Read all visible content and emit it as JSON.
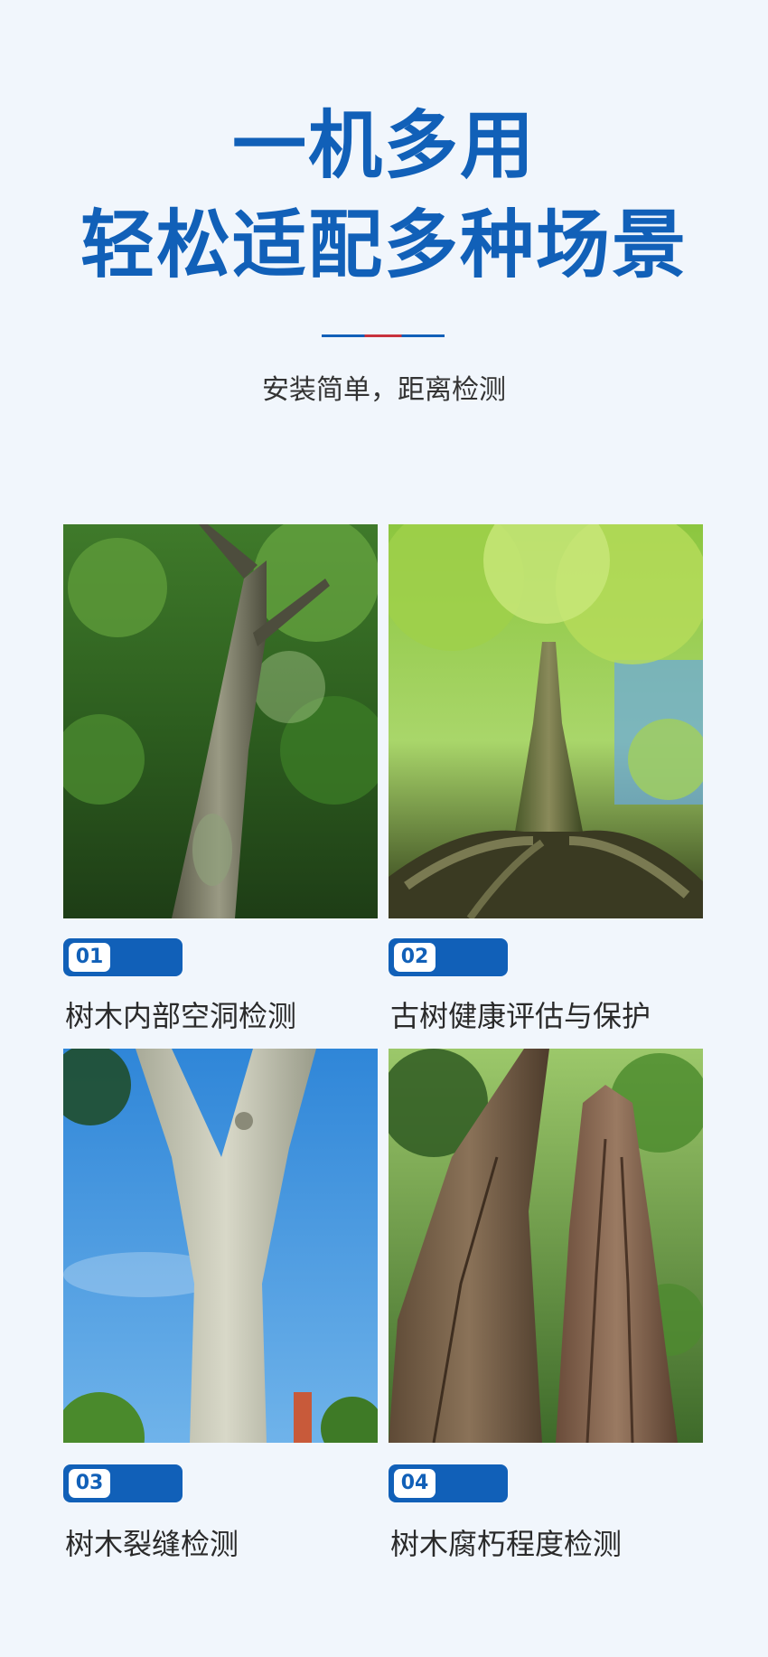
{
  "header": {
    "title_line1": "一机多用",
    "title_line2": "轻松适配多种场景",
    "subtitle": "安装简单，距离检测"
  },
  "accent_color": "#1160b8",
  "divider_accent_color": "#c8323c",
  "cards": [
    {
      "number": "01",
      "caption": "树木内部空洞检测",
      "photo": "mossy-tree-trunk-photo"
    },
    {
      "number": "02",
      "caption": "古树健康评估与保护",
      "photo": "ancient-tree-roots-photo"
    },
    {
      "number": "03",
      "caption": "树木裂缝检测",
      "photo": "pale-tree-trunk-sky-photo"
    },
    {
      "number": "04",
      "caption": "树木腐朽程度检测",
      "photo": "decayed-twin-trunks-photo"
    }
  ]
}
